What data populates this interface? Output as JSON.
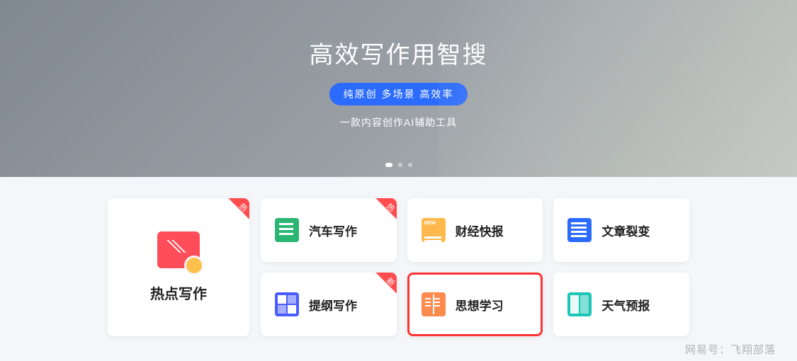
{
  "hero": {
    "title": "高效写作用智搜",
    "badge": "纯原创 多场景 高效率",
    "subtitle": "一款内容创作AI辅助工具"
  },
  "featured": {
    "label": "热点写作",
    "badge": "热"
  },
  "cards": [
    {
      "label": "汽车写作",
      "icon": "ic-green",
      "badge": "热"
    },
    {
      "label": "财经快报",
      "icon": "ic-orange",
      "badge": ""
    },
    {
      "label": "文章裂变",
      "icon": "ic-blue",
      "badge": ""
    },
    {
      "label": "提纲写作",
      "icon": "ic-grid",
      "badge": "新"
    },
    {
      "label": "思想学习",
      "icon": "ic-book",
      "badge": "",
      "highlight": true
    },
    {
      "label": "天气预报",
      "icon": "ic-teal",
      "badge": ""
    }
  ],
  "watermark": "网易号：飞翔部落"
}
